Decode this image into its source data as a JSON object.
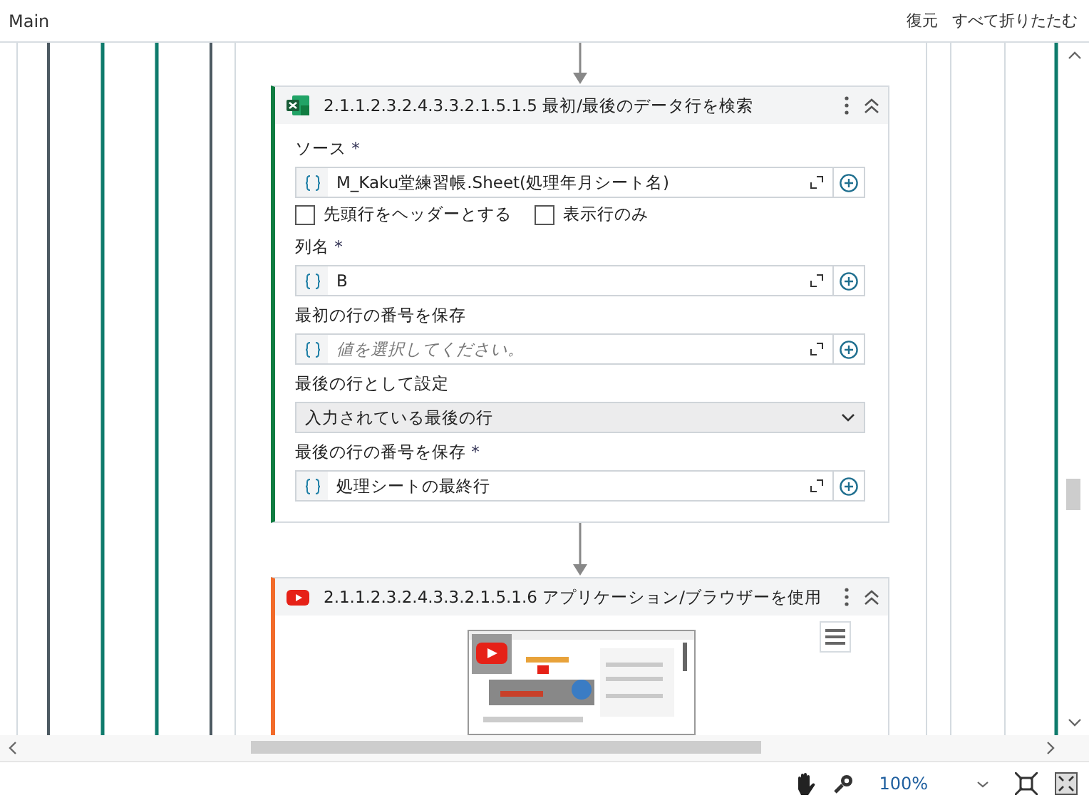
{
  "header": {
    "title": "Main",
    "actions": [
      "復元",
      "すべて折りたたむ"
    ]
  },
  "cards": [
    {
      "kind": "excel",
      "title": "2.1.1.2.3.2.4.3.3.2.1.5.1.5 最初/最後のデータ行を検索",
      "fields": [
        {
          "kind": "input",
          "label": "ソース",
          "required_mark": "*",
          "value": "M_Kaku堂練習帳.Sheet(処理年月シート名)"
        },
        {
          "kind": "checkboxes",
          "items": [
            {
              "label": "先頭行をヘッダーとする",
              "checked": false
            },
            {
              "label": "表示行のみ",
              "checked": false
            }
          ]
        },
        {
          "kind": "input",
          "label": "列名",
          "required_mark": "*",
          "value": "B"
        },
        {
          "kind": "input",
          "label": "最初の行の番号を保存",
          "placeholder": "値を選択してください。"
        },
        {
          "kind": "select",
          "label": "最後の行として設定",
          "value": "入力されている最後の行"
        },
        {
          "kind": "input",
          "label": "最後の行の番号を保存",
          "required_mark": "*",
          "value": "処理シートの最終行"
        }
      ]
    },
    {
      "kind": "browser",
      "title": "2.1.1.2.3.2.4.3.3.2.1.5.1.6 アプリケーション/ブラウザーを使用"
    }
  ],
  "status_bar": {
    "zoom": "100%"
  }
}
